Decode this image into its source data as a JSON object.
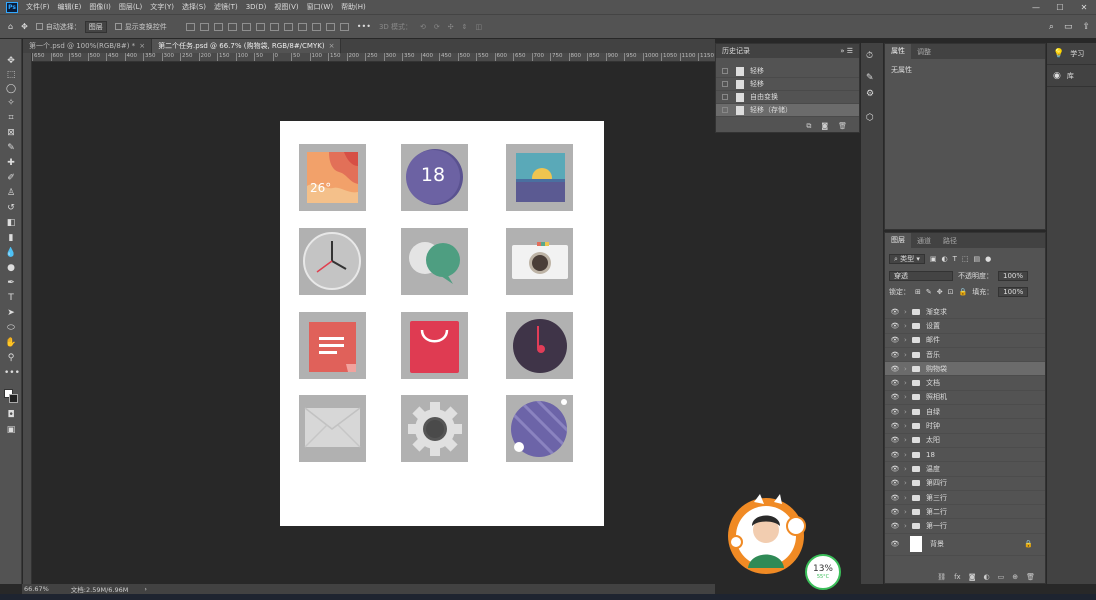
{
  "menu": {
    "logo": "Ps",
    "items": [
      "文件(F)",
      "编辑(E)",
      "图像(I)",
      "图层(L)",
      "文字(Y)",
      "选择(S)",
      "滤镜(T)",
      "3D(D)",
      "视图(V)",
      "窗口(W)",
      "帮助(H)"
    ]
  },
  "options": {
    "auto_select_label": "自动选择：",
    "auto_select_value": "图层",
    "show_transform_label": "显示变换控件",
    "mode_3d_label": "3D 模式："
  },
  "tabs": [
    {
      "label": "第一个.psd @ 100%(RGB/8#) *",
      "close": "×"
    },
    {
      "label": "第二个任务.psd @ 66.7% (购物袋, RGB/8#/CMYK)",
      "close": "×"
    }
  ],
  "ruler": {
    "ticks": [
      "650",
      "600",
      "550",
      "500",
      "450",
      "400",
      "350",
      "300",
      "250",
      "200",
      "150",
      "100",
      "50",
      "0",
      "50",
      "100",
      "150",
      "200",
      "250",
      "300",
      "350",
      "400",
      "450",
      "500",
      "550",
      "600",
      "650",
      "700",
      "750",
      "800",
      "850",
      "900",
      "950",
      "1000",
      "1050",
      "1100",
      "1150"
    ]
  },
  "canvas": {
    "icons": [
      {
        "name": "weather",
        "text": "26°"
      },
      {
        "name": "calendar",
        "text": "18"
      },
      {
        "name": "sunset",
        "text": ""
      },
      {
        "name": "clock",
        "text": ""
      },
      {
        "name": "chat",
        "text": ""
      },
      {
        "name": "camera",
        "text": ""
      },
      {
        "name": "document",
        "text": ""
      },
      {
        "name": "shopping-bag",
        "text": ""
      },
      {
        "name": "music",
        "text": ""
      },
      {
        "name": "mail",
        "text": ""
      },
      {
        "name": "settings",
        "text": ""
      },
      {
        "name": "planet",
        "text": ""
      }
    ]
  },
  "history": {
    "title": "历史记录",
    "items": [
      {
        "label": "轻移",
        "selected": false
      },
      {
        "label": "轻移",
        "selected": false
      },
      {
        "label": "自由变换",
        "selected": false
      },
      {
        "label": "轻移（存储）",
        "selected": true
      }
    ]
  },
  "properties": {
    "tabs": [
      "属性",
      "调整"
    ],
    "empty_text": "无属性"
  },
  "learn": {
    "items": [
      {
        "icon": "lightbulb-icon",
        "label": "学习"
      },
      {
        "icon": "library-icon",
        "label": "库"
      }
    ]
  },
  "layers": {
    "tabs": [
      "图层",
      "通道",
      "路径"
    ],
    "filter_label": "类型",
    "blend_mode": "穿透",
    "opacity_label": "不透明度：",
    "opacity_value": "100%",
    "lock_label": "锁定：",
    "fill_label": "填充：",
    "fill_value": "100%",
    "groups": [
      {
        "name": "渐变求",
        "selected": false
      },
      {
        "name": "设置",
        "selected": false
      },
      {
        "name": "邮件",
        "selected": false
      },
      {
        "name": "音乐",
        "selected": false
      },
      {
        "name": "购物袋",
        "selected": true
      },
      {
        "name": "文档",
        "selected": false
      },
      {
        "name": "照相机",
        "selected": false
      },
      {
        "name": "自绿",
        "selected": false
      },
      {
        "name": "时钟",
        "selected": false
      },
      {
        "name": "太阳",
        "selected": false
      },
      {
        "name": "18",
        "selected": false
      },
      {
        "name": "温度",
        "selected": false
      },
      {
        "name": "第四行",
        "selected": false
      },
      {
        "name": "第三行",
        "selected": false
      },
      {
        "name": "第二行",
        "selected": false
      },
      {
        "name": "第一行",
        "selected": false
      }
    ],
    "background": "背景"
  },
  "status": {
    "zoom": "66.67%",
    "doc": "文档:2.59M/6.96M"
  },
  "meter": {
    "percent": "13%",
    "temp": "55°C"
  },
  "colors": {
    "accent": "#31a8ff",
    "purple": "#6c62a3",
    "red": "#df3b52",
    "teal": "#4e9e81"
  }
}
